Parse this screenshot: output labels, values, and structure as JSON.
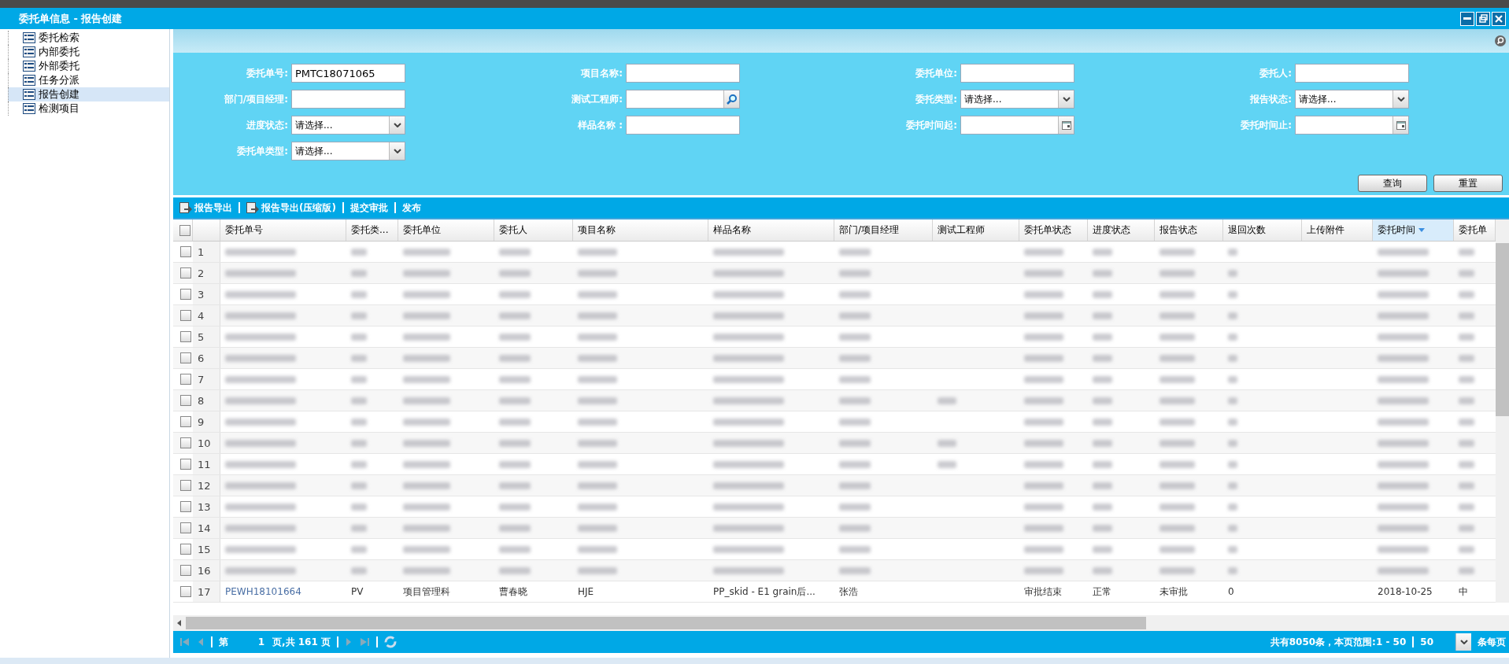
{
  "window": {
    "title": "委托单信息 - 报告创建"
  },
  "sidebar": {
    "items": [
      {
        "label": "委托检索",
        "selected": false
      },
      {
        "label": "内部委托",
        "selected": false
      },
      {
        "label": "外部委托",
        "selected": false
      },
      {
        "label": "任务分派",
        "selected": false
      },
      {
        "label": "报告创建",
        "selected": true
      },
      {
        "label": "检测项目",
        "selected": false
      }
    ]
  },
  "filters": [
    {
      "label": "委托单号:",
      "kind": "text",
      "value": "PMTC18071065"
    },
    {
      "label": "项目名称:",
      "kind": "text"
    },
    {
      "label": "委托单位:",
      "kind": "text"
    },
    {
      "label": "委托人:",
      "kind": "text"
    },
    {
      "label": "部门/项目经理:",
      "kind": "text"
    },
    {
      "label": "测试工程师:",
      "kind": "search"
    },
    {
      "label": "委托类型:",
      "kind": "select",
      "value": "请选择..."
    },
    {
      "label": "报告状态:",
      "kind": "select",
      "value": "请选择..."
    },
    {
      "label": "进度状态:",
      "kind": "select",
      "value": "请选择..."
    },
    {
      "label": "样品名称 :",
      "kind": "text"
    },
    {
      "label": "委托时间起:",
      "kind": "date"
    },
    {
      "label": "委托时间止:",
      "kind": "date"
    },
    {
      "label": "委托单类型:",
      "kind": "select",
      "value": "请选择..."
    }
  ],
  "form_buttons": [
    "查询",
    "重置"
  ],
  "toolbar": [
    {
      "label": "报告导出",
      "icon": true
    },
    {
      "label": "报告导出(压缩版)",
      "icon": true
    },
    {
      "label": "提交审批",
      "icon": false
    },
    {
      "label": "发布",
      "icon": false
    }
  ],
  "table": {
    "all_checked": false,
    "columns": [
      {
        "label": "委托单号",
        "sorted": false
      },
      {
        "label": "委托类...",
        "sorted": false
      },
      {
        "label": "委托单位",
        "sorted": false
      },
      {
        "label": "委托人",
        "sorted": false
      },
      {
        "label": "项目名称",
        "sorted": false
      },
      {
        "label": "样品名称",
        "sorted": false
      },
      {
        "label": "部门/项目经理",
        "sorted": false
      },
      {
        "label": "测试工程师",
        "sorted": false
      },
      {
        "label": "委托单状态",
        "sorted": false
      },
      {
        "label": "进度状态",
        "sorted": false
      },
      {
        "label": "报告状态",
        "sorted": false
      },
      {
        "label": "退回次数",
        "sorted": false
      },
      {
        "label": "上传附件",
        "sorted": false
      },
      {
        "label": "委托时间",
        "sorted": true
      },
      {
        "label": "委托单",
        "sorted": false
      }
    ],
    "rows": [
      {
        "no": "1",
        "checked": false,
        "blurred": true,
        "engineer": false
      },
      {
        "no": "2",
        "checked": false,
        "blurred": true,
        "engineer": false
      },
      {
        "no": "3",
        "checked": false,
        "blurred": true,
        "engineer": false
      },
      {
        "no": "4",
        "checked": false,
        "blurred": true,
        "engineer": false
      },
      {
        "no": "5",
        "checked": false,
        "blurred": true,
        "engineer": false
      },
      {
        "no": "6",
        "checked": false,
        "blurred": true,
        "engineer": false
      },
      {
        "no": "7",
        "checked": false,
        "blurred": true,
        "engineer": false
      },
      {
        "no": "8",
        "checked": false,
        "blurred": true,
        "engineer": true
      },
      {
        "no": "9",
        "checked": false,
        "blurred": true,
        "engineer": false
      },
      {
        "no": "10",
        "checked": false,
        "blurred": true,
        "engineer": true
      },
      {
        "no": "11",
        "checked": false,
        "blurred": true,
        "engineer": true
      },
      {
        "no": "12",
        "checked": false,
        "blurred": true,
        "engineer": false
      },
      {
        "no": "13",
        "checked": false,
        "blurred": true,
        "engineer": false
      },
      {
        "no": "14",
        "checked": false,
        "blurred": true,
        "engineer": false
      },
      {
        "no": "15",
        "checked": false,
        "blurred": true,
        "engineer": false
      },
      {
        "no": "16",
        "checked": false,
        "blurred": true,
        "engineer": false
      },
      {
        "no": "17",
        "checked": false,
        "blurred": false,
        "cells": [
          "PEWH18101664",
          "PV",
          "项目管理科",
          "曹春晓",
          "HJE",
          "PP_skid - E1 grain后...",
          "张浩",
          "",
          "审批结束",
          "正常",
          "未审批",
          "0",
          "",
          "2018-10-25",
          "中"
        ]
      }
    ]
  },
  "pager": {
    "page_prefix": "第",
    "page": "1",
    "page_suffix": "页,共 161 页",
    "summary": "共有8050条，本页范围:1 - 50",
    "page_size": "50",
    "page_size_suffix": "条每页"
  }
}
